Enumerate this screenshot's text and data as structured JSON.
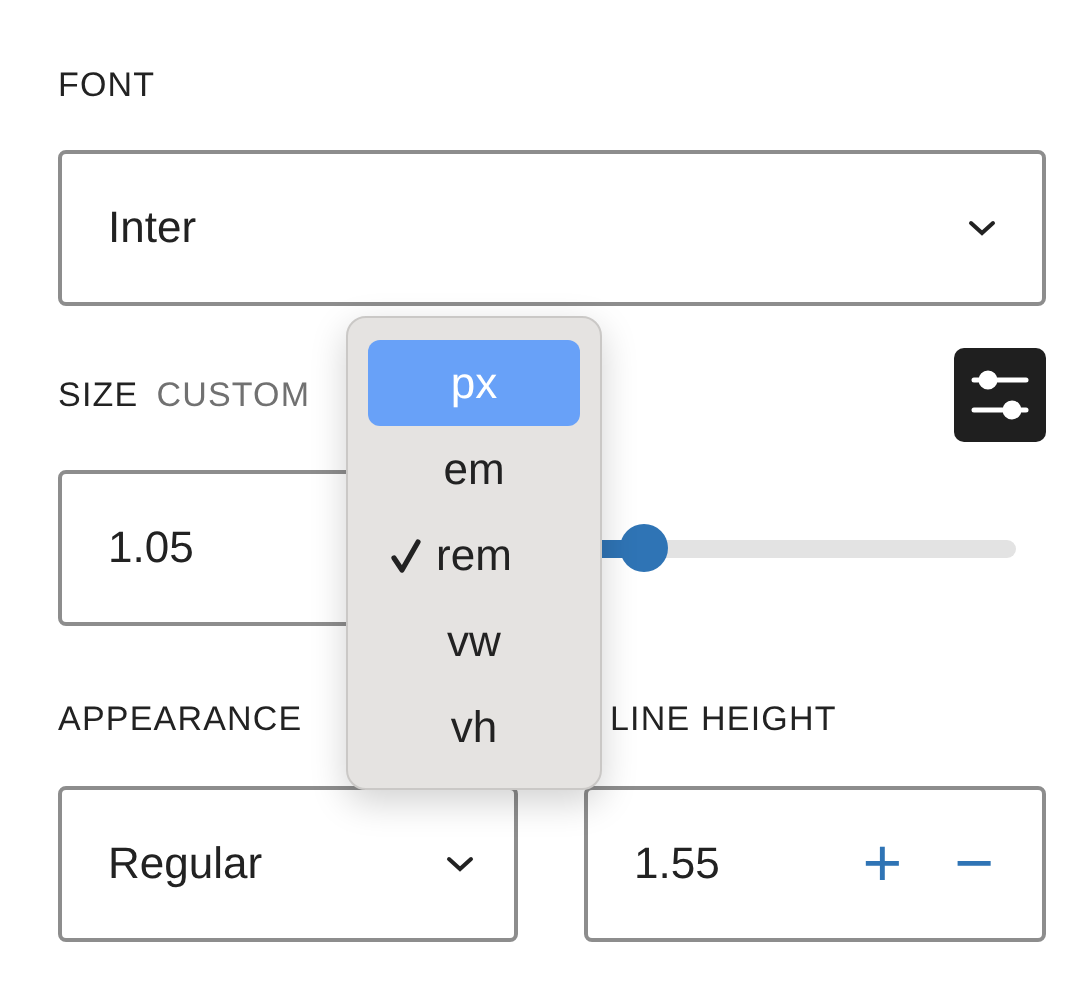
{
  "font": {
    "label": "FONT",
    "value": "Inter"
  },
  "size": {
    "label": "SIZE",
    "unit_label": "CUSTOM",
    "value": "1.05",
    "slider": {
      "level": 0.33
    }
  },
  "unit_menu": {
    "items": [
      {
        "label": "px",
        "selected": true,
        "checked": false
      },
      {
        "label": "em",
        "selected": false,
        "checked": false
      },
      {
        "label": "rem",
        "selected": false,
        "checked": true
      },
      {
        "label": "vw",
        "selected": false,
        "checked": false
      },
      {
        "label": "vh",
        "selected": false,
        "checked": false
      }
    ]
  },
  "appearance": {
    "label": "APPEARANCE",
    "value": "Regular"
  },
  "line_height": {
    "label": "LINE HEIGHT",
    "value": "1.55",
    "increment": "+",
    "decrement": "−"
  }
}
